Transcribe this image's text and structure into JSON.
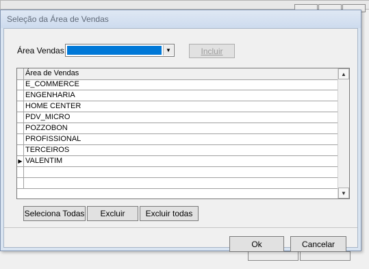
{
  "dialog": {
    "title": "Seleção da Área de Vendas"
  },
  "filter": {
    "label": "Área Vendas:",
    "combo_value": "",
    "incluir_label": "Incluir"
  },
  "grid": {
    "column_header": "Área de Vendas",
    "rows": [
      {
        "value": "E_COMMERCE"
      },
      {
        "value": "ENGENHARIA"
      },
      {
        "value": "HOME CENTER"
      },
      {
        "value": "PDV_MICRO"
      },
      {
        "value": "POZZOBON"
      },
      {
        "value": "PROFISSIONAL"
      },
      {
        "value": "TERCEIROS"
      },
      {
        "value": "VALENTIM",
        "current": true
      },
      {
        "value": ""
      },
      {
        "value": ""
      }
    ]
  },
  "actions": {
    "seleciona_todas": "Seleciona Todas",
    "excluir": "Excluir",
    "excluir_todas": "Excluir todas"
  },
  "footer": {
    "ok": "Ok",
    "cancelar": "Cancelar"
  },
  "colors": {
    "selection": "#0078d7",
    "title_text": "#606a79"
  }
}
